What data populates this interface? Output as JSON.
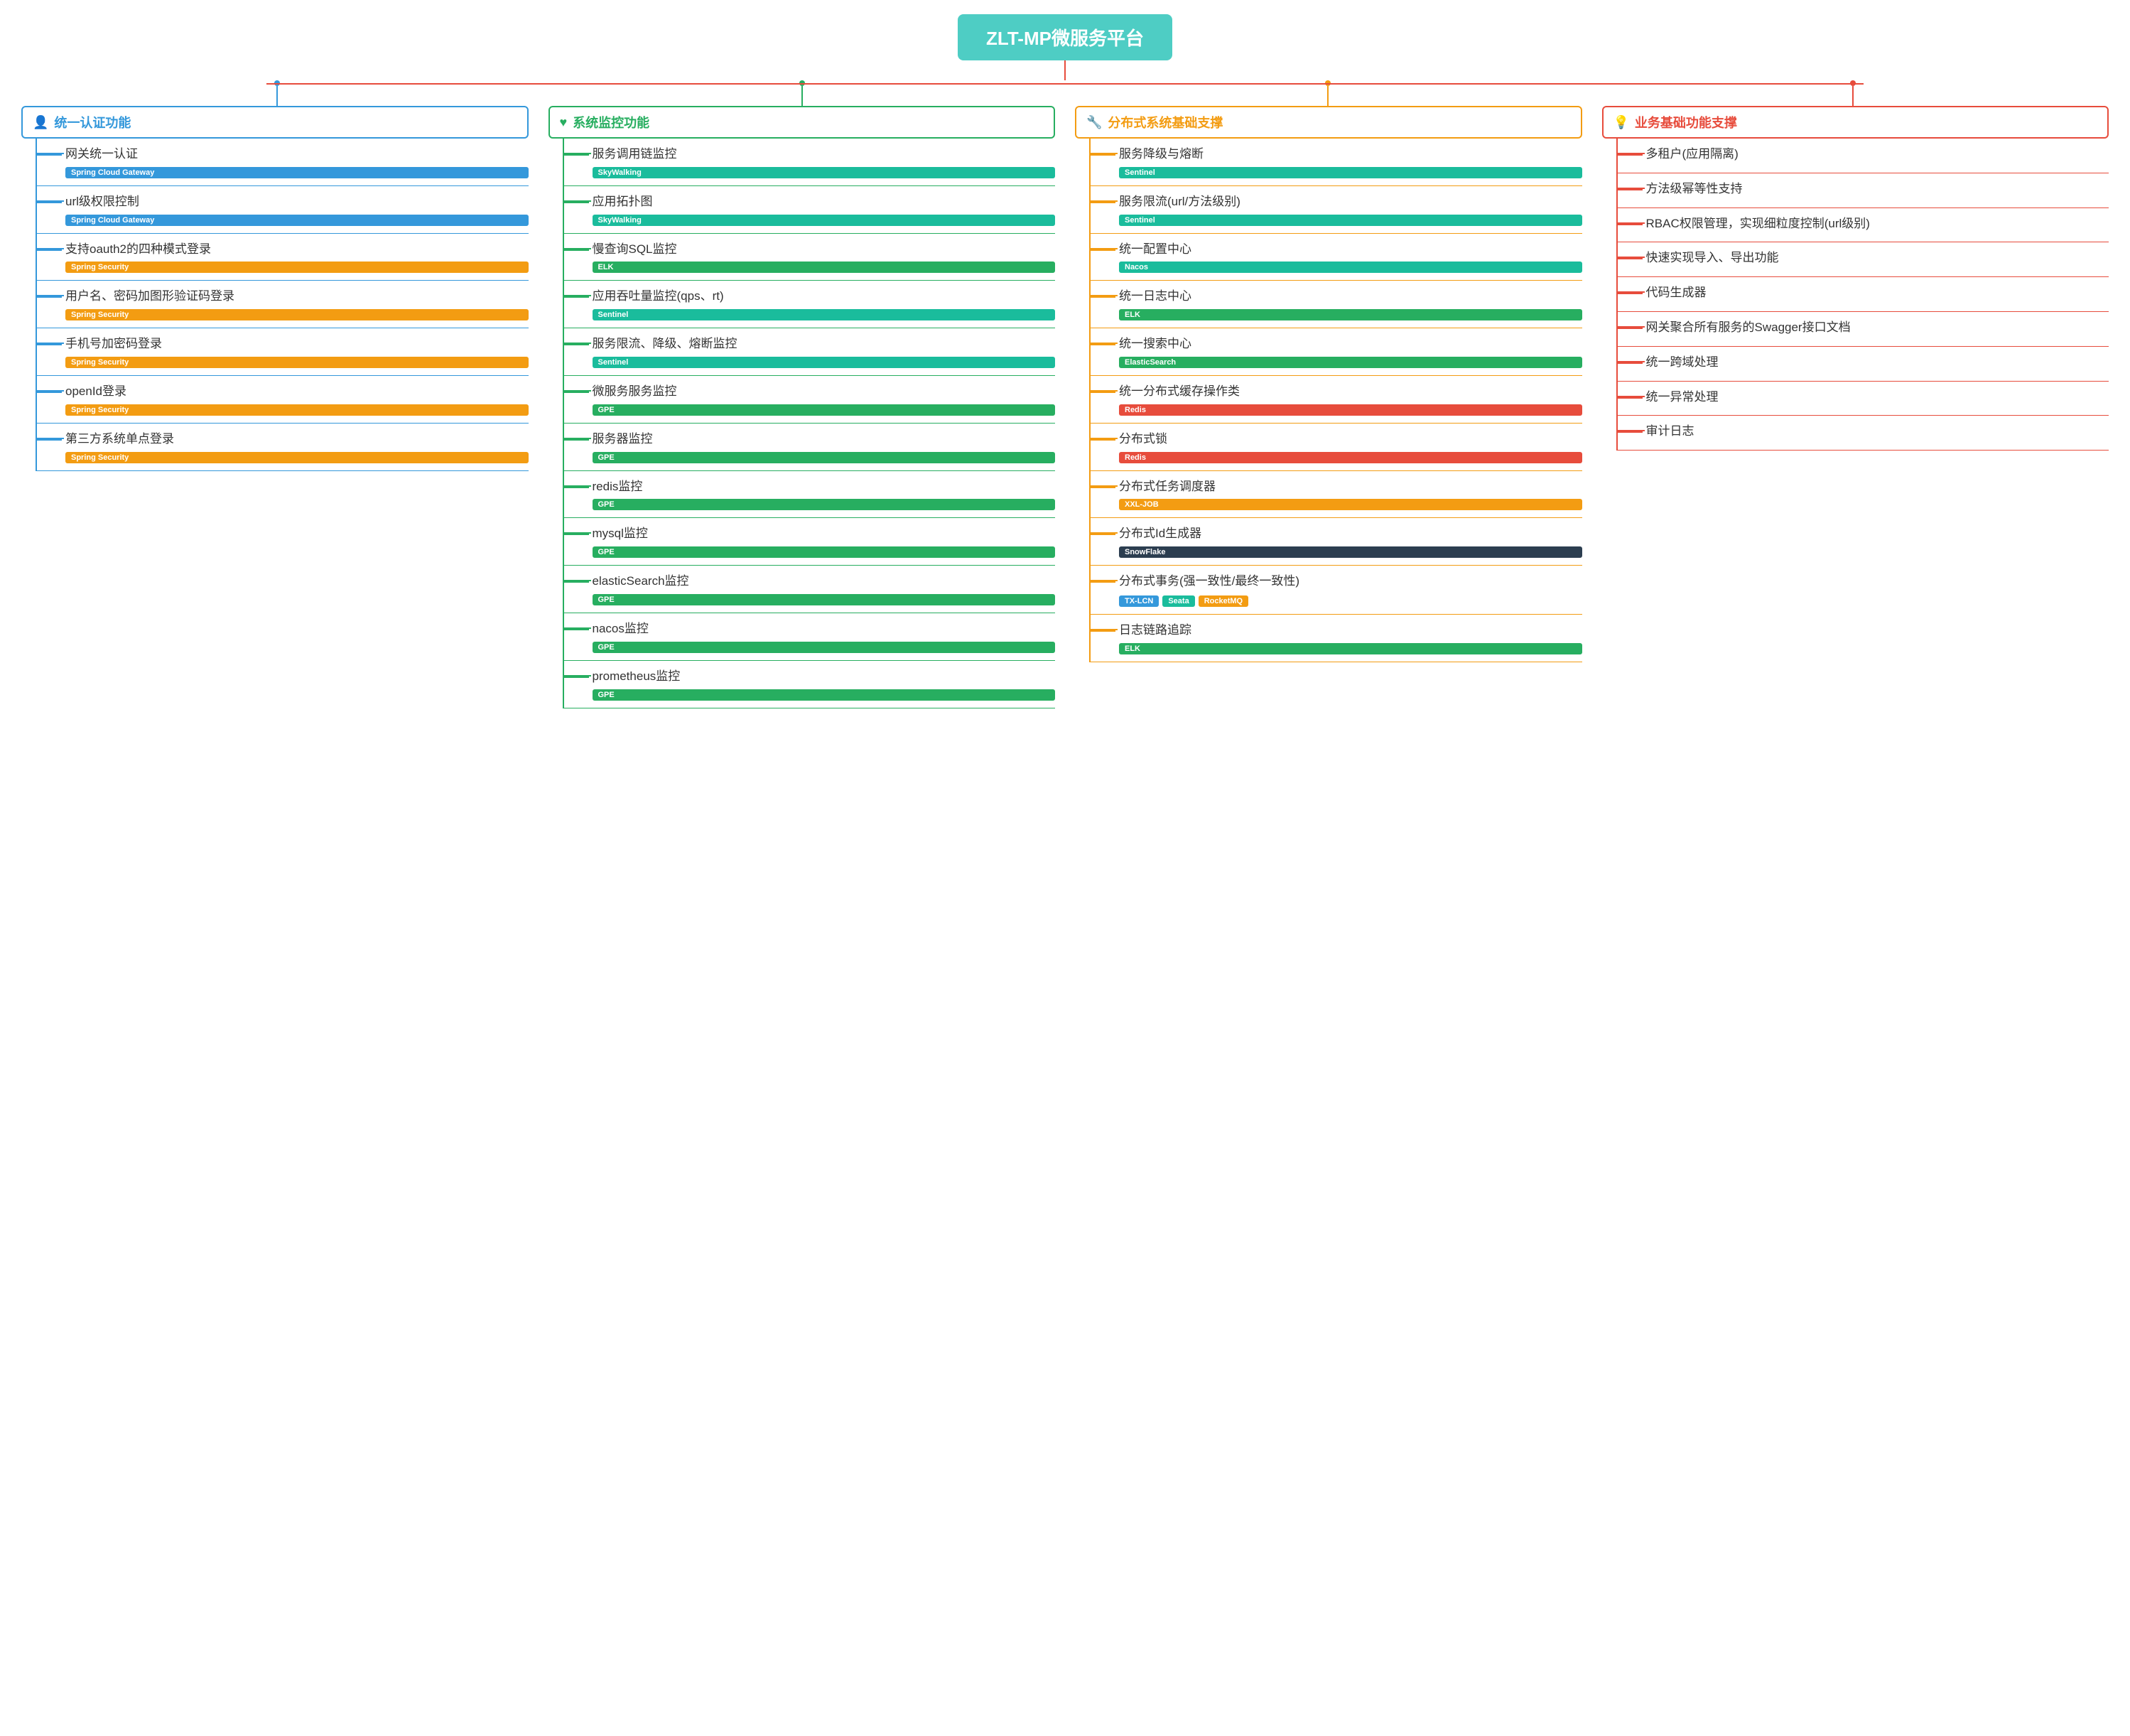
{
  "root": {
    "title": "ZLT-MP微服务平台"
  },
  "columns": [
    {
      "id": "auth",
      "colorClass": "col-auth",
      "headerColor": "#3498db",
      "icon": "👤",
      "title": "统一认证功能",
      "items": [
        {
          "title": "网关统一认证",
          "tags": [
            {
              "label": "Spring Cloud Gateway",
              "class": "tag-blue"
            }
          ]
        },
        {
          "title": "url级权限控制",
          "tags": [
            {
              "label": "Spring Cloud Gateway",
              "class": "tag-blue"
            }
          ]
        },
        {
          "title": "支持oauth2的四种模式登录",
          "tags": [
            {
              "label": "Spring Security",
              "class": "tag-orange"
            }
          ]
        },
        {
          "title": "用户名、密码加图形验证码登录",
          "tags": [
            {
              "label": "Spring Security",
              "class": "tag-orange"
            }
          ]
        },
        {
          "title": "手机号加密码登录",
          "tags": [
            {
              "label": "Spring Security",
              "class": "tag-orange"
            }
          ]
        },
        {
          "title": "openId登录",
          "tags": [
            {
              "label": "Spring Security",
              "class": "tag-orange"
            }
          ]
        },
        {
          "title": "第三方系统单点登录",
          "tags": [
            {
              "label": "Spring Security",
              "class": "tag-orange"
            }
          ]
        }
      ]
    },
    {
      "id": "monitor",
      "colorClass": "col-monitor",
      "headerColor": "#27ae60",
      "icon": "♥",
      "title": "系统监控功能",
      "items": [
        {
          "title": "服务调用链监控",
          "tags": [
            {
              "label": "SkyWalking",
              "class": "tag-teal"
            }
          ]
        },
        {
          "title": "应用拓扑图",
          "tags": [
            {
              "label": "SkyWalking",
              "class": "tag-teal"
            }
          ]
        },
        {
          "title": "慢查询SQL监控",
          "tags": [
            {
              "label": "ELK",
              "class": "tag-green"
            }
          ]
        },
        {
          "title": "应用吞吐量监控(qps、rt)",
          "tags": [
            {
              "label": "Sentinel",
              "class": "tag-teal"
            }
          ]
        },
        {
          "title": "服务限流、降级、熔断监控",
          "tags": [
            {
              "label": "Sentinel",
              "class": "tag-teal"
            }
          ]
        },
        {
          "title": "微服务服务监控",
          "tags": [
            {
              "label": "GPE",
              "class": "tag-green"
            }
          ]
        },
        {
          "title": "服务器监控",
          "tags": [
            {
              "label": "GPE",
              "class": "tag-green"
            }
          ]
        },
        {
          "title": "redis监控",
          "tags": [
            {
              "label": "GPE",
              "class": "tag-green"
            }
          ]
        },
        {
          "title": "mysql监控",
          "tags": [
            {
              "label": "GPE",
              "class": "tag-green"
            }
          ]
        },
        {
          "title": "elasticSearch监控",
          "tags": [
            {
              "label": "GPE",
              "class": "tag-green"
            }
          ]
        },
        {
          "title": "nacos监控",
          "tags": [
            {
              "label": "GPE",
              "class": "tag-green"
            }
          ]
        },
        {
          "title": "prometheus监控",
          "tags": [
            {
              "label": "GPE",
              "class": "tag-green"
            }
          ]
        }
      ]
    },
    {
      "id": "distributed",
      "colorClass": "col-dist",
      "headerColor": "#f39c12",
      "icon": "🔧",
      "title": "分布式系统基础支撑",
      "items": [
        {
          "title": "服务降级与熔断",
          "tags": [
            {
              "label": "Sentinel",
              "class": "tag-teal"
            }
          ]
        },
        {
          "title": "服务限流(url/方法级别)",
          "tags": [
            {
              "label": "Sentinel",
              "class": "tag-teal"
            }
          ]
        },
        {
          "title": "统一配置中心",
          "tags": [
            {
              "label": "Nacos",
              "class": "tag-teal"
            }
          ]
        },
        {
          "title": "统一日志中心",
          "tags": [
            {
              "label": "ELK",
              "class": "tag-green"
            }
          ]
        },
        {
          "title": "统一搜索中心",
          "tags": [
            {
              "label": "ElasticSearch",
              "class": "tag-green"
            }
          ]
        },
        {
          "title": "统一分布式缓存操作类",
          "tags": [
            {
              "label": "Redis",
              "class": "tag-red"
            }
          ]
        },
        {
          "title": "分布式锁",
          "tags": [
            {
              "label": "Redis",
              "class": "tag-red"
            }
          ]
        },
        {
          "title": "分布式任务调度器",
          "tags": [
            {
              "label": "XXL-JOB",
              "class": "tag-orange"
            }
          ]
        },
        {
          "title": "分布式Id生成器",
          "tags": [
            {
              "label": "SnowFlake",
              "class": "tag-dark"
            }
          ]
        },
        {
          "title": "分布式事务(强一致性/最终一致性)",
          "tags": [
            {
              "label": "TX-LCN",
              "class": "tag-blue"
            },
            {
              "label": "Seata",
              "class": "tag-teal"
            },
            {
              "label": "RocketMQ",
              "class": "tag-orange"
            }
          ]
        },
        {
          "title": "日志链路追踪",
          "tags": [
            {
              "label": "ELK",
              "class": "tag-green"
            }
          ]
        }
      ]
    },
    {
      "id": "business",
      "colorClass": "col-biz",
      "headerColor": "#e74c3c",
      "icon": "💡",
      "title": "业务基础功能支撑",
      "items": [
        {
          "title": "多租户(应用隔离)",
          "tags": []
        },
        {
          "title": "方法级幂等性支持",
          "tags": []
        },
        {
          "title": "RBAC权限管理，实现细粒度控制(url级别)",
          "tags": []
        },
        {
          "title": "快速实现导入、导出功能",
          "tags": []
        },
        {
          "title": "代码生成器",
          "tags": []
        },
        {
          "title": "网关聚合所有服务的Swagger接口文档",
          "tags": []
        },
        {
          "title": "统一跨域处理",
          "tags": []
        },
        {
          "title": "统一异常处理",
          "tags": []
        },
        {
          "title": "审计日志",
          "tags": []
        }
      ]
    }
  ]
}
